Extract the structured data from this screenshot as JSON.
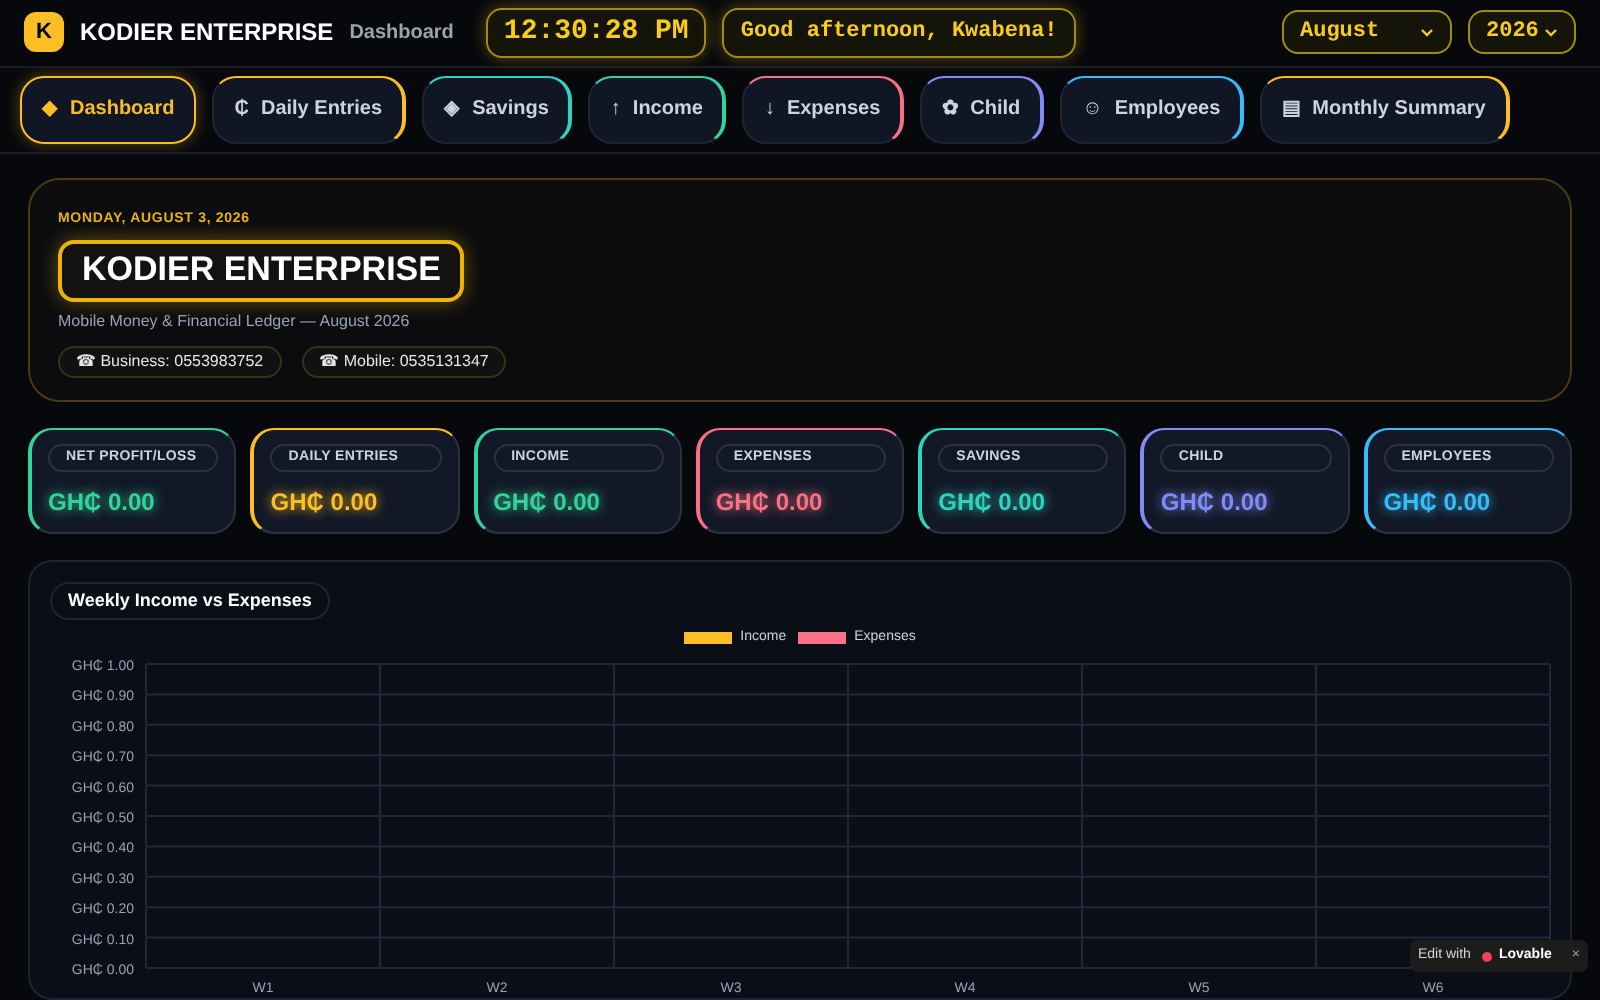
{
  "header": {
    "logo_letter": "K",
    "brand": "KODIER ENTERPRISE",
    "page": "Dashboard",
    "clock": "12:30:28 PM",
    "greeting": "Good afternoon, Kwabena!",
    "month_select": "August",
    "year_select": "2026"
  },
  "tabs": [
    {
      "icon": "◆",
      "label": "Dashboard",
      "selected": true,
      "color": "#fbbf24"
    },
    {
      "icon": "₵",
      "label": "Daily Entries",
      "selected": false,
      "color": "#fbbf24"
    },
    {
      "icon": "◈",
      "label": "Savings",
      "selected": false,
      "color": "#2dd4bf"
    },
    {
      "icon": "↑",
      "label": "Income",
      "selected": false,
      "color": "#34d399"
    },
    {
      "icon": "↓",
      "label": "Expenses",
      "selected": false,
      "color": "#f87185"
    },
    {
      "icon": "✿",
      "label": "Child",
      "selected": false,
      "color": "#818cf8"
    },
    {
      "icon": "☺",
      "label": "Employees",
      "selected": false,
      "color": "#38bdf8"
    },
    {
      "icon": "▤",
      "label": "Monthly Summary",
      "selected": false,
      "color": "#fbbf24"
    }
  ],
  "hero": {
    "date": "MONDAY, AUGUST 3, 2026",
    "title": "KODIER ENTERPRISE",
    "subtitle": "Mobile Money & Financial Ledger — August 2026",
    "contacts": [
      "☎ Business: 0553983752",
      "☎ Mobile: 0535131347"
    ]
  },
  "stats": [
    {
      "label": "NET PROFIT/LOSS",
      "value": "GH₵ 0.00",
      "color": "#34d399"
    },
    {
      "label": "DAILY ENTRIES",
      "value": "GH₵ 0.00",
      "color": "#fbbf24"
    },
    {
      "label": "INCOME",
      "value": "GH₵ 0.00",
      "color": "#34d399"
    },
    {
      "label": "EXPENSES",
      "value": "GH₵ 0.00",
      "color": "#f87185"
    },
    {
      "label": "SAVINGS",
      "value": "GH₵ 0.00",
      "color": "#2dd4bf"
    },
    {
      "label": "CHILD",
      "value": "GH₵ 0.00",
      "color": "#818cf8"
    },
    {
      "label": "EMPLOYEES",
      "value": "GH₵ 0.00",
      "color": "#38bdf8"
    }
  ],
  "chart": {
    "title": "Weekly Income vs Expenses",
    "chart_data": {
      "type": "bar",
      "categories": [
        "W1",
        "W2",
        "W3",
        "W4",
        "W5",
        "W6"
      ],
      "series": [
        {
          "name": "Income",
          "color": "#fbbf24",
          "values": [
            0,
            0,
            0,
            0,
            0,
            0
          ]
        },
        {
          "name": "Expenses",
          "color": "#f87185",
          "values": [
            0,
            0,
            0,
            0,
            0,
            0
          ]
        }
      ],
      "grid": true,
      "ylim": [
        0,
        1
      ],
      "yticks": [
        {
          "value": 0,
          "label": "GH₵ 0.00"
        },
        {
          "value": 0.1,
          "label": "GH₵ 0.10"
        },
        {
          "value": 0.2,
          "label": "GH₵ 0.20"
        },
        {
          "value": 0.3,
          "label": "GH₵ 0.30"
        },
        {
          "value": 0.4,
          "label": "GH₵ 0.40"
        },
        {
          "value": 0.5,
          "label": "GH₵ 0.50"
        },
        {
          "value": 0.6,
          "label": "GH₵ 0.60"
        },
        {
          "value": 0.7,
          "label": "GH₵ 0.70"
        },
        {
          "value": 0.8,
          "label": "GH₵ 0.80"
        },
        {
          "value": 0.9,
          "label": "GH₵ 0.90"
        },
        {
          "value": 1,
          "label": "GH₵ 1.00"
        }
      ]
    }
  },
  "badge": {
    "prefix": "Edit with",
    "brand": "Lovable",
    "close": "×"
  }
}
